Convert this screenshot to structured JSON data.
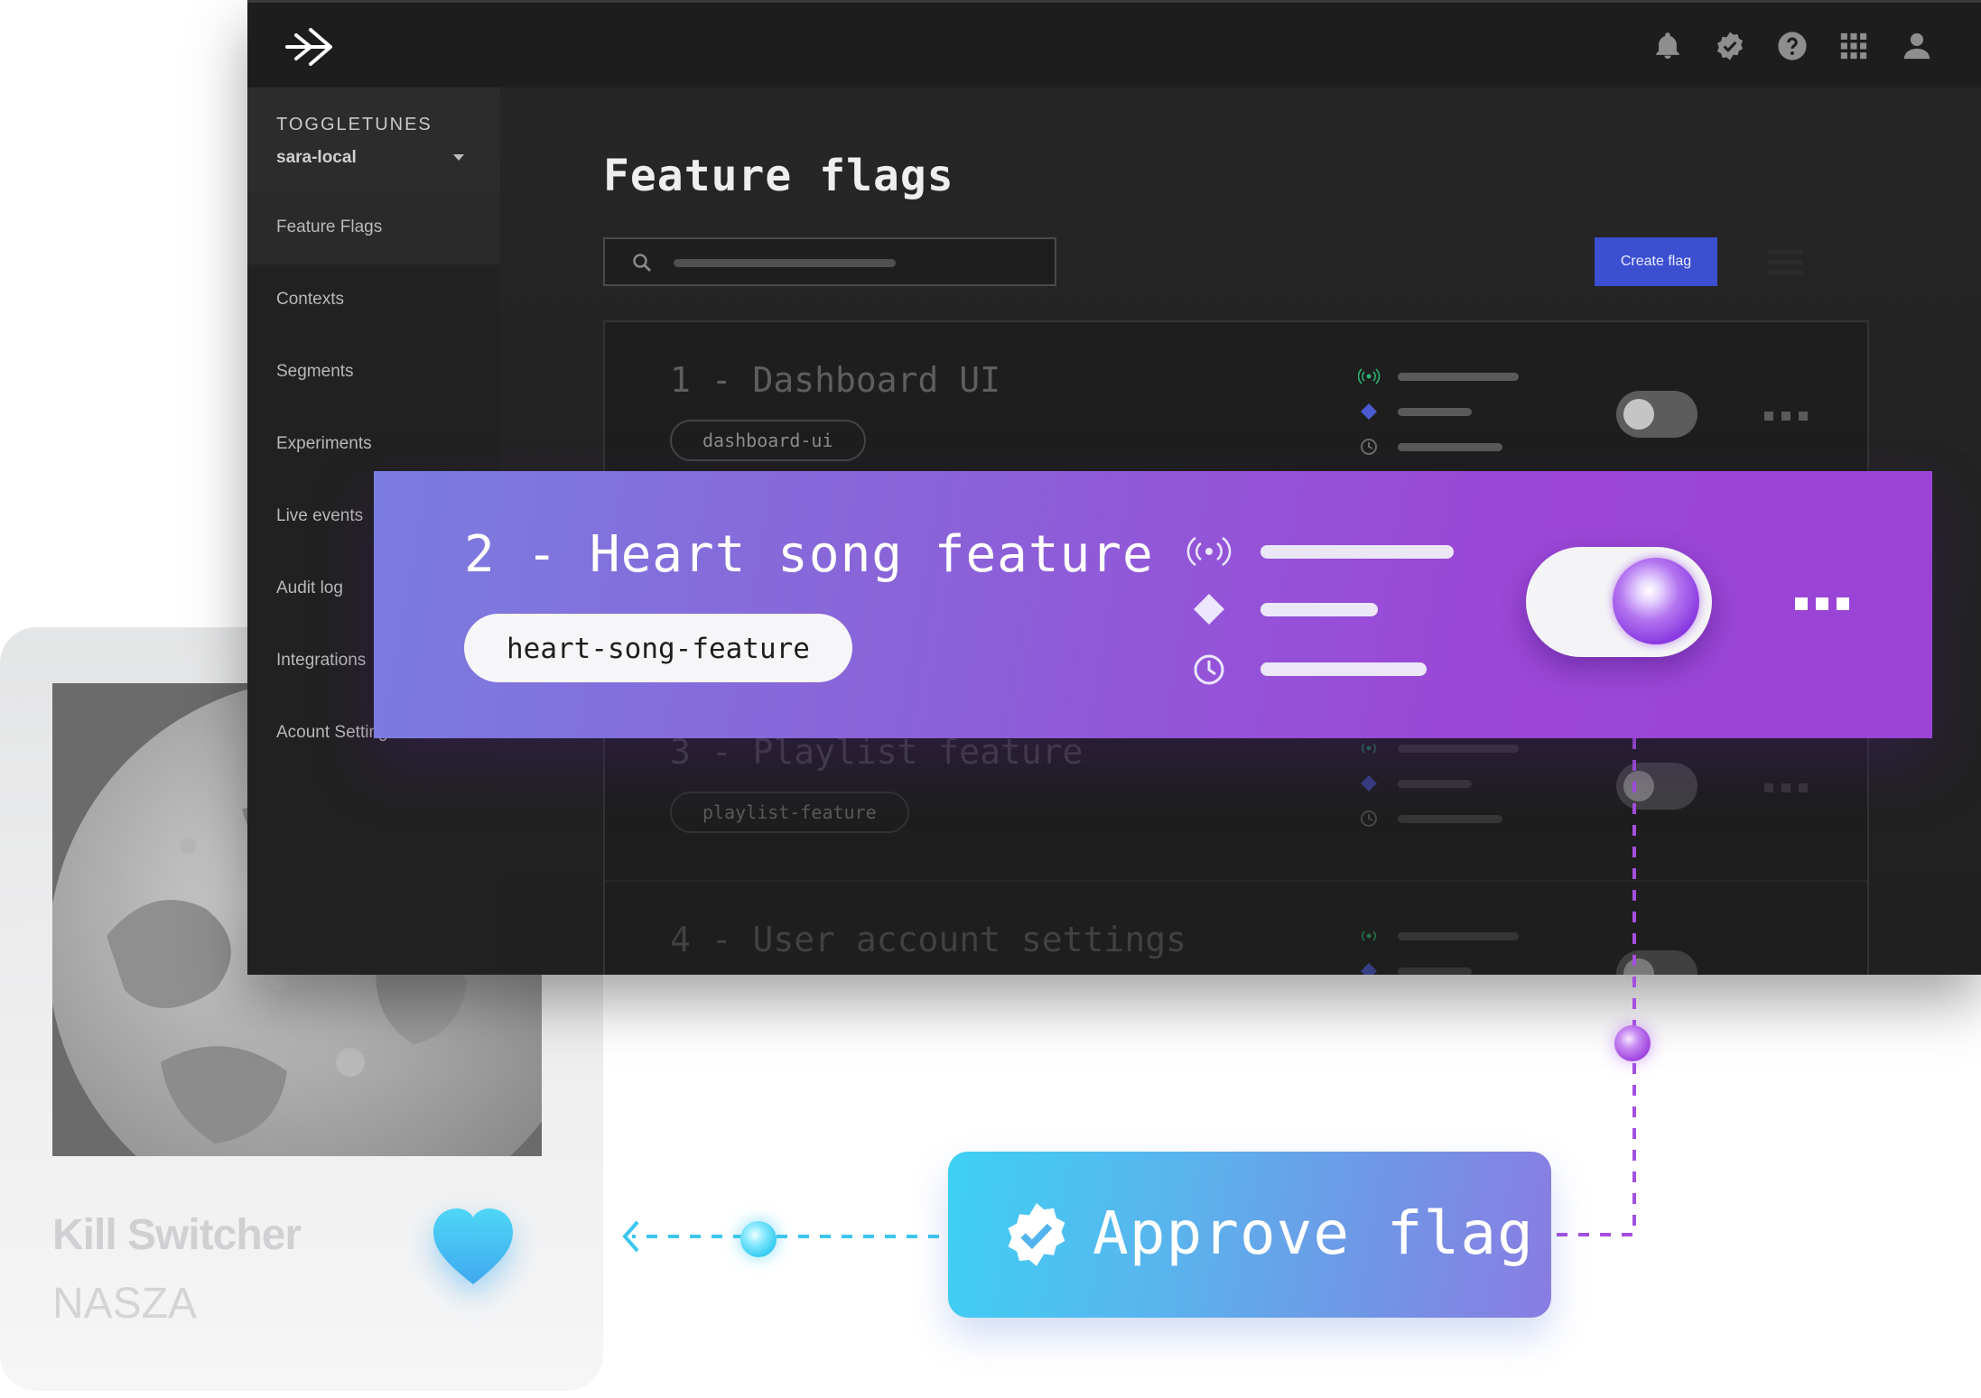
{
  "app": {
    "org": "TOGGLETUNES",
    "environment": "sara-local",
    "nav": [
      {
        "label": "Feature Flags",
        "active": true
      },
      {
        "label": "Contexts"
      },
      {
        "label": "Segments"
      },
      {
        "label": "Experiments"
      },
      {
        "label": "Live events"
      },
      {
        "label": "Audit log"
      },
      {
        "label": "Integrations"
      },
      {
        "label": "Acount Settings"
      }
    ],
    "topbar_icons": [
      "bell-icon",
      "verified-badge-icon",
      "help-icon",
      "apps-grid-icon",
      "user-icon"
    ],
    "page_title": "Feature flags",
    "create_button": "Create flag",
    "accent_color": "#3b4fd0"
  },
  "flags": [
    {
      "title": "1 - Dashboard UI",
      "key": "dashboard-ui",
      "enabled": false
    },
    {
      "title": "2 - Heart song feature",
      "key": "heart-song-feature",
      "enabled": true
    },
    {
      "title": "3 - Playlist feature",
      "key": "playlist-feature",
      "enabled": false
    },
    {
      "title": "4 - User account settings",
      "key": "",
      "enabled": false
    }
  ],
  "approve": {
    "label": "Approve flag"
  },
  "player": {
    "song": "Kill Switcher",
    "artist": "NASZA",
    "liked": true
  }
}
